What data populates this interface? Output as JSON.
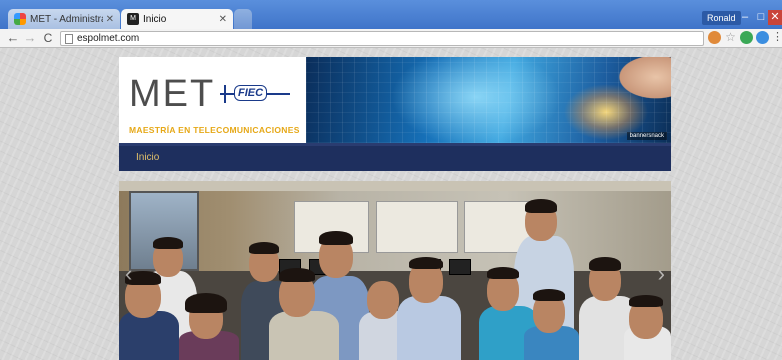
{
  "browser": {
    "tabs": [
      {
        "title": "MET - Administration - Pi",
        "active": false,
        "favicon": "joomla-icon"
      },
      {
        "title": "Inicio",
        "active": true,
        "favicon": "met-icon"
      }
    ],
    "user": "Ronald",
    "url": "espolmet.com",
    "window_controls": {
      "minimize": "–",
      "maximize": "□",
      "close": "✕"
    }
  },
  "header": {
    "logo_text": "MET",
    "fiec_text": "FIEC",
    "tagline": "MAESTRÍA EN TELECOMUNICACIONES",
    "image_credit": "bannersnack"
  },
  "nav": {
    "items": [
      {
        "label": "Inicio"
      }
    ]
  },
  "carousel": {
    "prev_icon": "‹",
    "next_icon": "›"
  },
  "colors": {
    "nav_bg": "#1e2f5e",
    "nav_text": "#e1c16a",
    "tagline": "#e6a817",
    "chrome_blue": "#4a80d2"
  }
}
